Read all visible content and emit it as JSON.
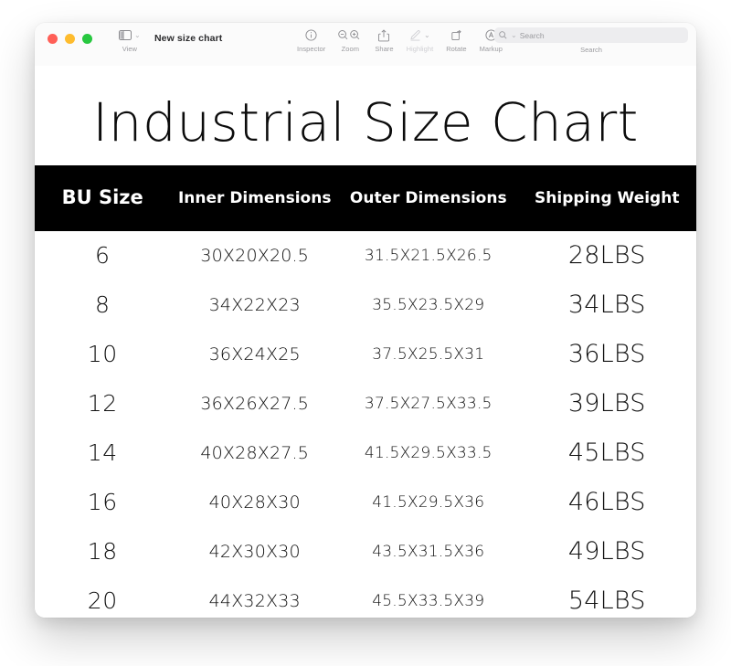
{
  "window": {
    "title": "New size chart",
    "traffic_lights": [
      {
        "name": "close",
        "color": "#ff5f57"
      },
      {
        "name": "minimize",
        "color": "#febc2e"
      },
      {
        "name": "maximize",
        "color": "#28c840"
      }
    ]
  },
  "toolbar": {
    "view": {
      "label": "View",
      "icon": "sidebar-icon"
    },
    "items": [
      {
        "label": "Inspector",
        "icon": "info-circle-icon",
        "disabled": false
      },
      {
        "label": "Zoom",
        "icon": "magnifier-icon",
        "disabled": false
      },
      {
        "label": "Share",
        "icon": "share-icon",
        "disabled": false
      },
      {
        "label": "Highlight",
        "icon": "pen-icon",
        "disabled": true
      },
      {
        "label": "Rotate",
        "icon": "rotate-icon",
        "disabled": false
      },
      {
        "label": "Markup",
        "icon": "markup-icon",
        "disabled": false
      }
    ]
  },
  "search": {
    "placeholder": "Search",
    "value": "",
    "caption": "Search"
  },
  "document": {
    "title": "Industrial Size Chart",
    "header_background": "#000000",
    "header_text_color": "#ffffff"
  },
  "chart_data": {
    "type": "table",
    "title": "Industrial Size Chart",
    "columns": [
      "BU Size",
      "Inner Dimensions",
      "Outer Dimensions",
      "Shipping Weight"
    ],
    "rows": [
      [
        "6",
        "30X20X20.5",
        "31.5X21.5X26.5",
        "28LBS"
      ],
      [
        "8",
        "34X22X23",
        "35.5X23.5X29",
        "34LBS"
      ],
      [
        "10",
        "36X24X25",
        "37.5X25.5X31",
        "36LBS"
      ],
      [
        "12",
        "36X26X27.5",
        "37.5X27.5X33.5",
        "39LBS"
      ],
      [
        "14",
        "40X28X27.5",
        "41.5X29.5X33.5",
        "45LBS"
      ],
      [
        "16",
        "40X28X30",
        "41.5X29.5X36",
        "46LBS"
      ],
      [
        "18",
        "42X30X30",
        "43.5X31.5X36",
        "49LBS"
      ],
      [
        "20",
        "44X32X33",
        "45.5X33.5X39",
        "54LBS"
      ]
    ]
  }
}
